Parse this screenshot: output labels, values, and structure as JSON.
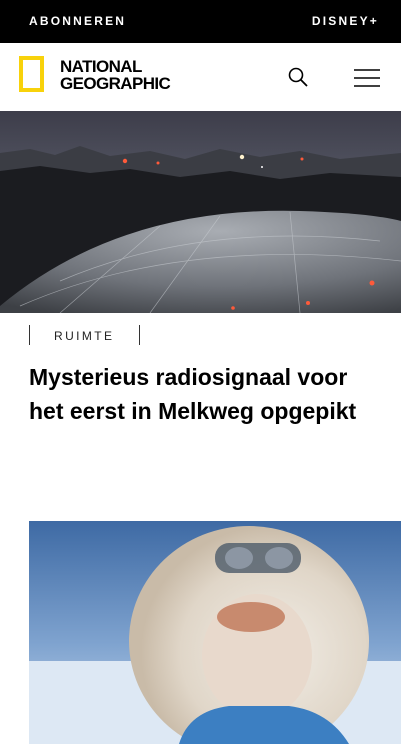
{
  "topbar": {
    "subscribe": "ABONNEREN",
    "disney": "DISNEY+"
  },
  "logo": {
    "line1": "NATIONAL",
    "line2": "GEOGRAPHIC",
    "frame_color": "#f8d20b"
  },
  "header": {
    "search_icon": "search-icon",
    "menu_icon": "hamburger-menu-icon"
  },
  "article1": {
    "tag": "RUIMTE",
    "headline": "Mysterieus radiosignaal voor het eerst in Melkweg opgepikt"
  },
  "colors": {
    "bar": "#000000",
    "accent": "#f8d20b"
  }
}
